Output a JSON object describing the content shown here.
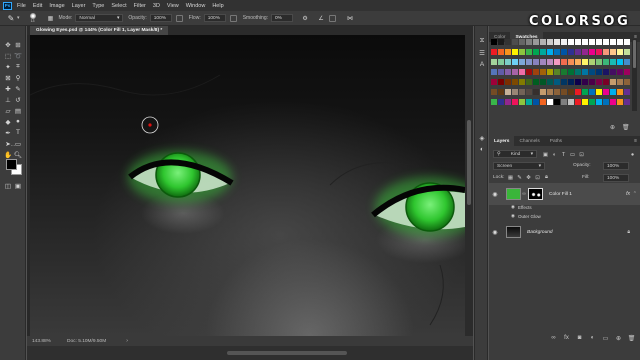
{
  "menubar": {
    "logo": "Ps",
    "items": [
      "File",
      "Edit",
      "Image",
      "Layer",
      "Type",
      "Select",
      "Filter",
      "3D",
      "View",
      "Window",
      "Help"
    ]
  },
  "options_bar": {
    "brush_size": "13",
    "mode_label": "Mode:",
    "mode_value": "Normal",
    "opacity_label": "Opacity:",
    "opacity_value": "100%",
    "flow_label": "Flow:",
    "flow_value": "100%",
    "smoothing_label": "Smoothing:",
    "smoothing_value": "0%"
  },
  "document": {
    "tab_title": "Glowing Eyes.psd @ 144% (Color Fill 1, Layer Mask/8) *",
    "eye_color": "#3ed23e"
  },
  "status_bar": {
    "zoom": "143.88%",
    "doc_info": "Doc: 5.10M/9.50M"
  },
  "watermark": "COLORSOG",
  "swatches_panel": {
    "tabs": [
      "Color",
      "Swatches"
    ],
    "active_tab": "Swatches",
    "rows": [
      [
        "#000000",
        "#1a1a1a",
        "#333333",
        "#4d4d4d",
        "#666666",
        "#808080",
        "#999999",
        "#b3b3b3",
        "#cccccc",
        "#e6e6e6",
        "#f2f2f2",
        "#ffffff",
        "#ffffff",
        "#ffffff",
        "#ffffff",
        "#ffffff",
        "#ffffff",
        "#ffffff",
        "#ffffff",
        "#ffffff"
      ],
      [
        "#ed1c24",
        "#f26522",
        "#f7941d",
        "#fff200",
        "#8dc63f",
        "#39b54a",
        "#00a651",
        "#00a99d",
        "#00aeef",
        "#0072bc",
        "#0054a6",
        "#2e3192",
        "#662d91",
        "#92278f",
        "#ec008c",
        "#ed145b",
        "#f7977a",
        "#fdc68a",
        "#fff799",
        "#c4df9b"
      ],
      [
        "#a3d39c",
        "#82ca9c",
        "#7accc8",
        "#6dcff6",
        "#7da7d9",
        "#8393ca",
        "#8781bd",
        "#a187be",
        "#bd8cbf",
        "#f49ac1",
        "#f26c4f",
        "#f68e56",
        "#fbaf5d",
        "#fff568",
        "#acd373",
        "#7cc576",
        "#3bb878",
        "#1abbb4",
        "#00bff3",
        "#438ccb"
      ],
      [
        "#5574b9",
        "#605ca8",
        "#855fa8",
        "#a763a8",
        "#f06ea9",
        "#9e0b0f",
        "#a0410d",
        "#a36209",
        "#aba000",
        "#598527",
        "#197b30",
        "#007236",
        "#00746b",
        "#0076a3",
        "#004a80",
        "#003471",
        "#1b1464",
        "#440e62",
        "#630460",
        "#9e005d"
      ],
      [
        "#9e0039",
        "#790000",
        "#7b2e00",
        "#7d4900",
        "#827b00",
        "#406618",
        "#005e20",
        "#005826",
        "#005952",
        "#005b7f",
        "#003663",
        "#002157",
        "#0d004c",
        "#32004b",
        "#4b0049",
        "#7b0046",
        "#7a0026",
        "#c69c6d",
        "#a67c52",
        "#8c6239"
      ],
      [
        "#754c24",
        "#603913",
        "#c7b299",
        "#998675",
        "#736357",
        "#534741",
        "#362f2d",
        "#c69c6d",
        "#a67c52",
        "#8c6239",
        "#754c24",
        "#603913",
        "#ed1c24",
        "#00a651",
        "#0072bc",
        "#fff200",
        "#ec008c",
        "#00aeef",
        "#f7941d",
        "#662d91"
      ],
      [
        "#39b54a",
        "#2e3192",
        "#92278f",
        "#ed145b",
        "#8dc63f",
        "#00a99d",
        "#0054a6",
        "#f26522",
        "#ffffff",
        "#000000",
        "#808080",
        "#c0c0c0",
        "#ed1c24",
        "#fff200",
        "#00a651",
        "#00aeef",
        "#0072bc",
        "#ec008c",
        "#f7941d",
        "#662d91"
      ]
    ]
  },
  "layers_panel": {
    "tabs": [
      "Layers",
      "Channels",
      "Paths"
    ],
    "active_tab": "Layers",
    "filter_label": "Kind",
    "blend_mode": "Screen",
    "opacity_label": "Opacity:",
    "opacity_value": "100%",
    "lock_label": "Lock:",
    "fill_label": "Fill:",
    "fill_value": "100%",
    "layers": [
      {
        "name": "Color Fill 1",
        "fx": "fx",
        "effects_label": "Effects",
        "effect": "Outer Glow"
      },
      {
        "name": "Background"
      }
    ]
  }
}
